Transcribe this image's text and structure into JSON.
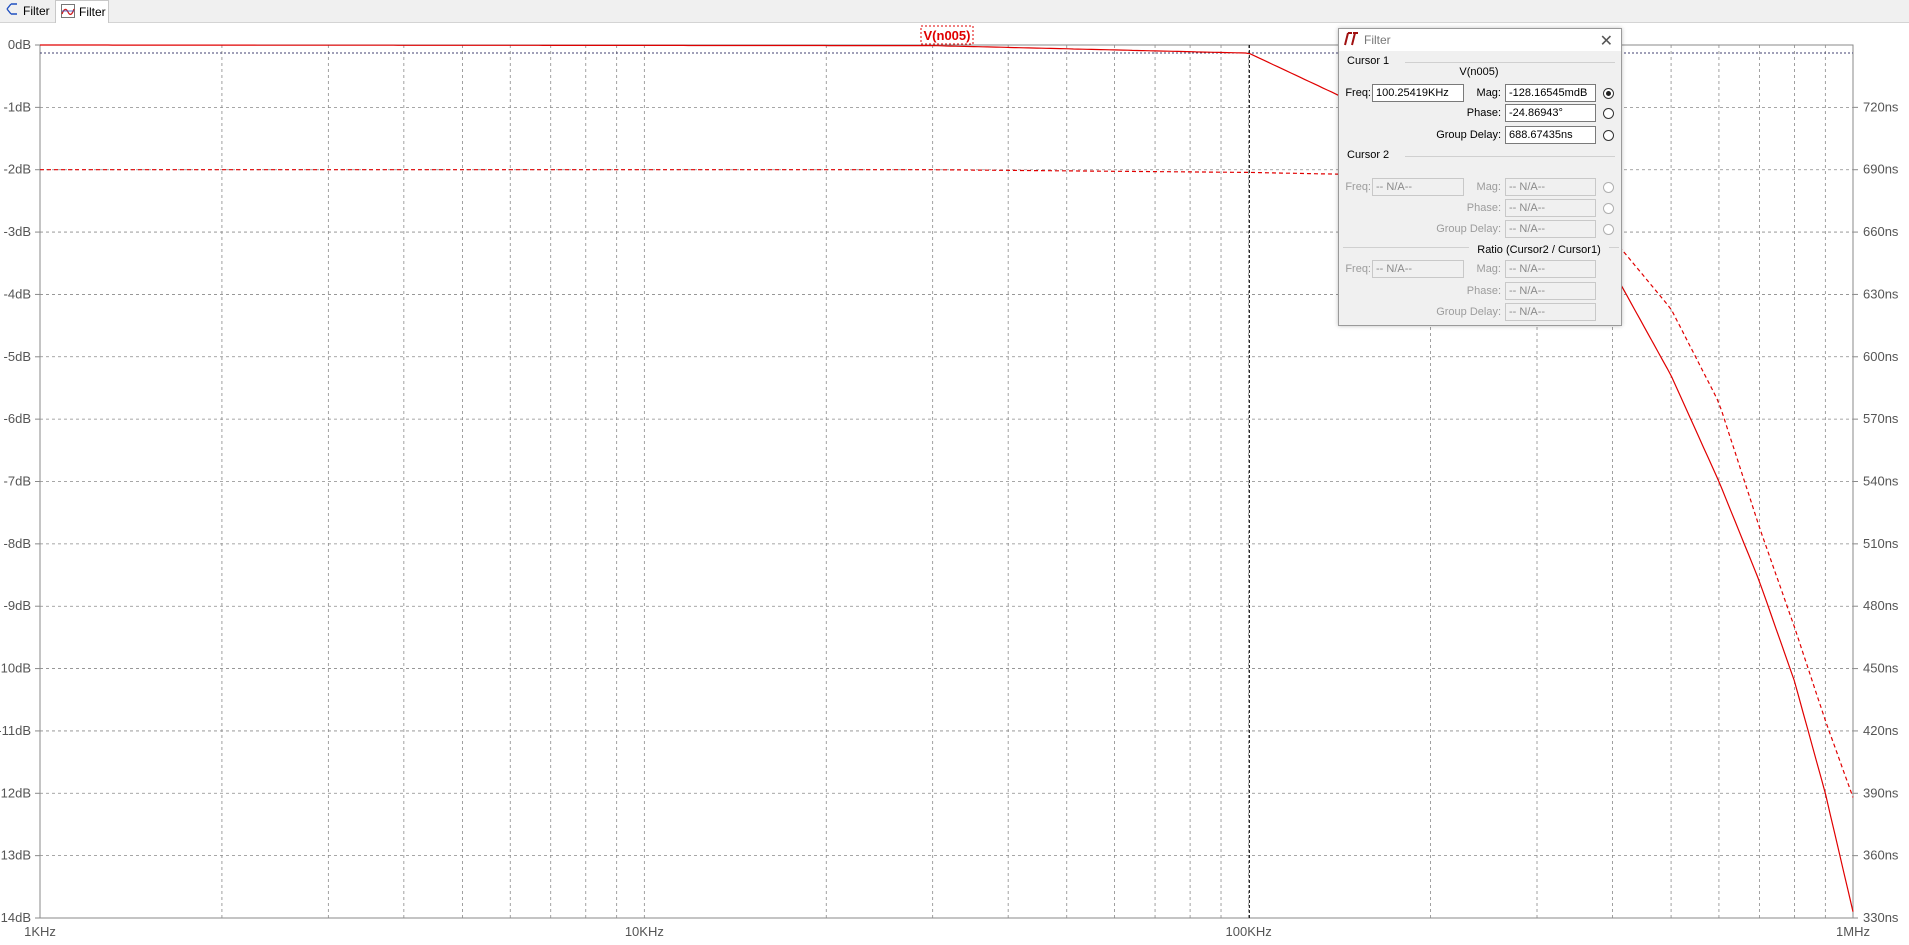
{
  "tabs": [
    {
      "label": "Filter",
      "icon": "schematic-icon"
    },
    {
      "label": "Filter",
      "icon": "waveform-icon"
    }
  ],
  "chart_data": {
    "type": "line",
    "title": "",
    "trace_label": "V(n005)",
    "x_scale": "log",
    "xlim_hz": [
      1000,
      1000000
    ],
    "x_ticks": [
      "1KHz",
      "10KHz",
      "100KHz",
      "1MHz"
    ],
    "y_left_ticks": [
      "0dB",
      "-1dB",
      "-2dB",
      "-3dB",
      "-4dB",
      "-5dB",
      "-6dB",
      "-7dB",
      "-8dB",
      "-9dB",
      "-10dB",
      "-11dB",
      "-12dB",
      "-13dB",
      "-14dB"
    ],
    "ylim_db": [
      -14,
      0
    ],
    "y_right_ticks": [
      "720ns",
      "690ns",
      "660ns",
      "630ns",
      "600ns",
      "570ns",
      "540ns",
      "510ns",
      "480ns",
      "450ns",
      "420ns",
      "390ns",
      "360ns",
      "330ns"
    ],
    "ylim_right_ns": [
      330,
      750
    ],
    "grid": true,
    "cursor_freq_hz": 100254.19,
    "series": [
      {
        "name": "V(n005)",
        "unit": "dB",
        "style": "solid",
        "color": "#e00000",
        "x": [
          1000,
          30000,
          100000,
          200000,
          300000,
          400000,
          500000,
          600000,
          700000,
          800000,
          900000,
          1000000
        ],
        "values": [
          0,
          -0.01,
          -0.13,
          -1.5,
          -2.5,
          -3.6,
          -5.3,
          -7.0,
          -8.6,
          -10.2,
          -12.0,
          -13.9
        ]
      },
      {
        "name": "V(n005)",
        "unit": "ns",
        "style": "dashed",
        "color": "#e00000",
        "x": [
          1000,
          30000,
          100000,
          200000,
          300000,
          400000,
          500000,
          600000,
          700000,
          800000,
          900000,
          1000000
        ],
        "values": [
          690,
          690,
          688.7,
          687,
          677,
          657,
          623,
          578,
          518,
          470,
          425,
          388
        ]
      }
    ],
    "colors": {
      "trace": "#e00000",
      "grid": "#8a8a8a",
      "cursor": "#000000"
    }
  },
  "dialog": {
    "title": "Filter",
    "cursor1": {
      "heading": "Cursor 1",
      "trace": "V(n005)",
      "freq_label": "Freq:",
      "freq": "100.25419KHz",
      "mag_label": "Mag:",
      "mag": "-128.16545mdB",
      "phase_label": "Phase:",
      "phase": "-24.86943°",
      "gd_label": "Group Delay:",
      "gd": "688.67435ns"
    },
    "cursor2": {
      "heading": "Cursor 2",
      "freq_label": "Freq:",
      "freq": "-- N/A--",
      "mag_label": "Mag:",
      "mag": "-- N/A--",
      "phase_label": "Phase:",
      "phase": "-- N/A--",
      "gd_label": "Group Delay:",
      "gd": "-- N/A--"
    },
    "ratio": {
      "heading": "Ratio (Cursor2 / Cursor1)",
      "freq_label": "Freq:",
      "freq": "-- N/A--",
      "mag_label": "Mag:",
      "mag": "-- N/A--",
      "phase_label": "Phase:",
      "phase": "-- N/A--",
      "gd_label": "Group Delay:",
      "gd": "-- N/A--"
    }
  }
}
